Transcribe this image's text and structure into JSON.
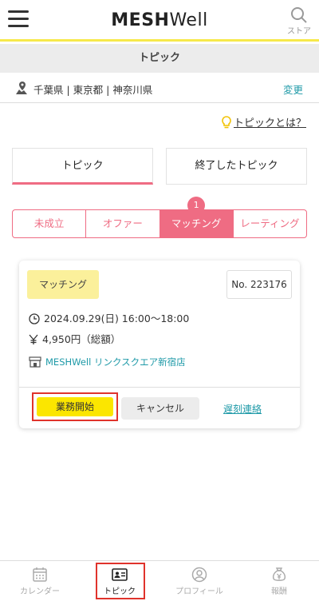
{
  "header": {
    "logo_bold": "MESH",
    "logo_light": "Well",
    "store_label": "ストア"
  },
  "title": "トピック",
  "area": {
    "text": "千葉県 | 東京都 | 神奈川県",
    "change": "変更"
  },
  "whatis": "トピックとは？",
  "tabs": {
    "topic": "トピック",
    "ended": "終了したトピック"
  },
  "segments": {
    "s1": "未成立",
    "s2": "オファー",
    "s3": "マッチング",
    "s4": "レーティング",
    "badge": "1"
  },
  "card": {
    "status": "マッチング",
    "number": "No. 223176",
    "datetime": "2024.09.29(日) 16:00〜18:00",
    "price": "4,950円（総額）",
    "store": "MESHWell リンクスクエア新宿店",
    "start_btn": "業務開始",
    "cancel_btn": "キャンセル",
    "late_link": "遅刻連絡"
  },
  "nav": {
    "calendar": "カレンダー",
    "topic": "トピック",
    "profile": "プロフィール",
    "reward": "報酬"
  },
  "colors": {
    "accent_pink": "#ef6c83",
    "accent_yellow": "#fbe600",
    "link_teal": "#1f9aa8",
    "highlight_red": "#e0332c"
  }
}
